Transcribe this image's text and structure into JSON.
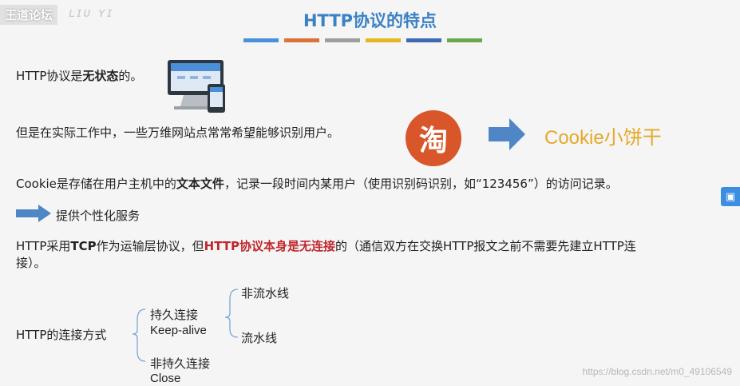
{
  "watermark": {
    "brand": "王道论坛",
    "signature": "LiuYiHu"
  },
  "title": "HTTP协议的特点",
  "title_bar_colors": [
    "#4a90d9",
    "#d9733a",
    "#9e9e9e",
    "#e6b820",
    "#3d6ab3",
    "#6aa84f"
  ],
  "line1": {
    "prefix": "HTTP协议是",
    "bold": "无状态",
    "suffix": "的。"
  },
  "line2": "但是在实际工作中，一些万维网站点常常希望能够识别用户。",
  "taobao_icon_text": "淘",
  "cookie_logo": "Cookie小饼干",
  "line3": {
    "prefix": "Cookie是存储在用户主机中的",
    "bold": "文本文件",
    "suffix": "，记录一段时间内某用户（使用识别码识别，如“123456”）的访问记录。"
  },
  "line4": "提供个性化服务",
  "line5": {
    "a": "HTTP采用",
    "tcp": "TCP",
    "b": "作为运输层协议，但",
    "red": "HTTP协议本身是无连接",
    "c": "的（通信双方在交换HTTP报文之前不需要先建立HTTP连"
  },
  "line5_cont": "接）。",
  "tree": {
    "root": "HTTP的连接方式",
    "persistent": {
      "label": "持久连接",
      "sub": "Keep-alive"
    },
    "non_pipeline": "非流水线",
    "pipeline": "流水线",
    "non_persistent": {
      "label": "非持久连接",
      "sub": "Close"
    }
  },
  "csdn_watermark": "https://blog.csdn.net/m0_49106549",
  "icons": [
    "computer-monitor-icon",
    "taobao-icon",
    "right-arrow-icon",
    "sidebar-tool-icon"
  ]
}
